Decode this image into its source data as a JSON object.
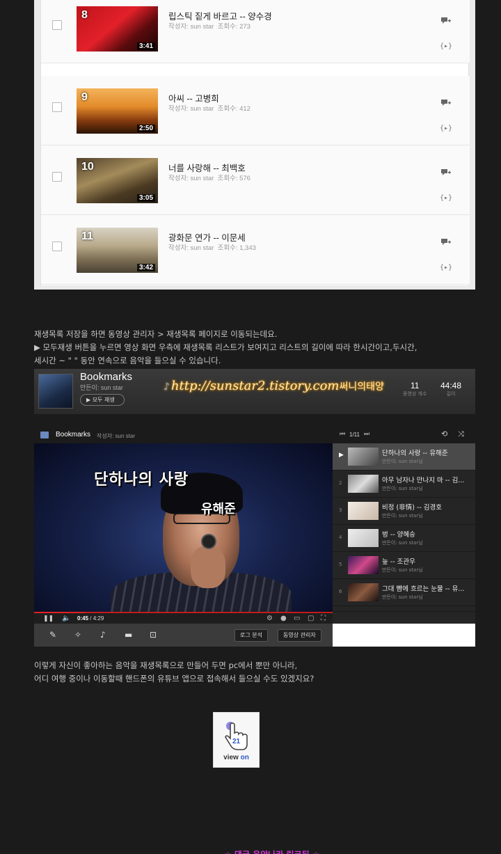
{
  "playlist": {
    "rows": [
      {
        "num": "8",
        "duration": "3:41",
        "title": "립스틱 짙게 바르고 -- 양수경",
        "author_label": "작성자:",
        "author": "sun star",
        "views_label": "조회수:",
        "views": "273"
      },
      {
        "num": "9",
        "duration": "2:50",
        "title": "아씨 -- 고병희",
        "author_label": "작성자:",
        "author": "sun star",
        "views_label": "조회수:",
        "views": "412"
      },
      {
        "num": "10",
        "duration": "3:05",
        "title": "너를 사랑해 -- 최백호",
        "author_label": "작성자:",
        "author": "sun star",
        "views_label": "조회수:",
        "views": "576"
      },
      {
        "num": "11",
        "duration": "3:42",
        "title": "광화문 연가 -- 이문세",
        "author_label": "작성자:",
        "author": "sun star",
        "views_label": "조회수:",
        "views": "1,343"
      }
    ]
  },
  "para1": {
    "line1": "재생목록 저장을 하면 동영상 관리자 > 재생목록 페이지로 이동되는데요.",
    "line2": "▶ 모두재생 버튼을 누르면 영상 화면 우측에 재생목록 리스트가 보여지고 리스트의 길이에 따라 한시간이고,두시간,",
    "line3": "세시간 ~ \" \" 동안 연속으로 음악을 들으실 수 있습니다."
  },
  "bookmarks_bar": {
    "title": "Bookmarks",
    "author": "만든이: sun star",
    "play_all": "▶ 모두 재생",
    "watermark_url": "http://sunstar2.tistory.com",
    "watermark_name": "써니의태양",
    "count_value": "11",
    "count_label": "동영상 개수",
    "time_value": "44:48",
    "time_label": "길이"
  },
  "player": {
    "header_title": "Bookmarks",
    "header_author": "작성자: sun star",
    "caption_title": "단하나의 사랑",
    "caption_artist": "유해준",
    "time_current": "0:45",
    "time_total": "/ 4:29",
    "progress_fraction": 0.17,
    "btn_log": "로그 분석",
    "btn_manager": "동영상 관리자",
    "queue_position": "1/11",
    "queue": [
      {
        "index": "1",
        "title": "단하나의 사랑 -- 유해준",
        "author": "만든이: sun star님",
        "active": true
      },
      {
        "index": "2",
        "title": "아무 남자나 만나지 마 -- 김...",
        "author": "만든이: sun star님"
      },
      {
        "index": "3",
        "title": "비정 (非情) -- 김경호",
        "author": "만든이: sun star님"
      },
      {
        "index": "4",
        "title": "벙 -- 양혜승",
        "author": "만든이: sun star님"
      },
      {
        "index": "5",
        "title": "늪 -- 조관우",
        "author": "만든이: sun star님"
      },
      {
        "index": "6",
        "title": "그대 뺨에 흐르는 눈물 -- 유...",
        "author": "만든이: sun star님"
      }
    ]
  },
  "para2": {
    "line1": "이렇게 자신이 좋아하는 음악을 재생목록으로 만들어 두면 pc에서 뿐만 아니라,",
    "line2": "어디 여행 중이나 이동할때 핸드폰의 유튜브 앱으로 접속해서 들으실 수도 있겠지요?"
  },
  "viewon": {
    "count": "21",
    "label_view": "view",
    "label_on": "on"
  },
  "bottom_link": "☆ 댓글 음악나라 링크된 ☆",
  "colors": {
    "background": "#1b1b1b",
    "accent_red": "#e52020",
    "link_magenta": "#d536d8",
    "viewon_blue": "#2a56c6"
  },
  "icons": [
    "checkbox-icon",
    "add-comment-icon",
    "embed-icon",
    "pause-icon",
    "volume-icon",
    "gear-icon",
    "fullscreen-icon",
    "pencil-icon",
    "magic-icon",
    "music-icon",
    "caption-icon",
    "shuffle-icon",
    "repeat-icon",
    "hand-pointer-icon"
  ]
}
